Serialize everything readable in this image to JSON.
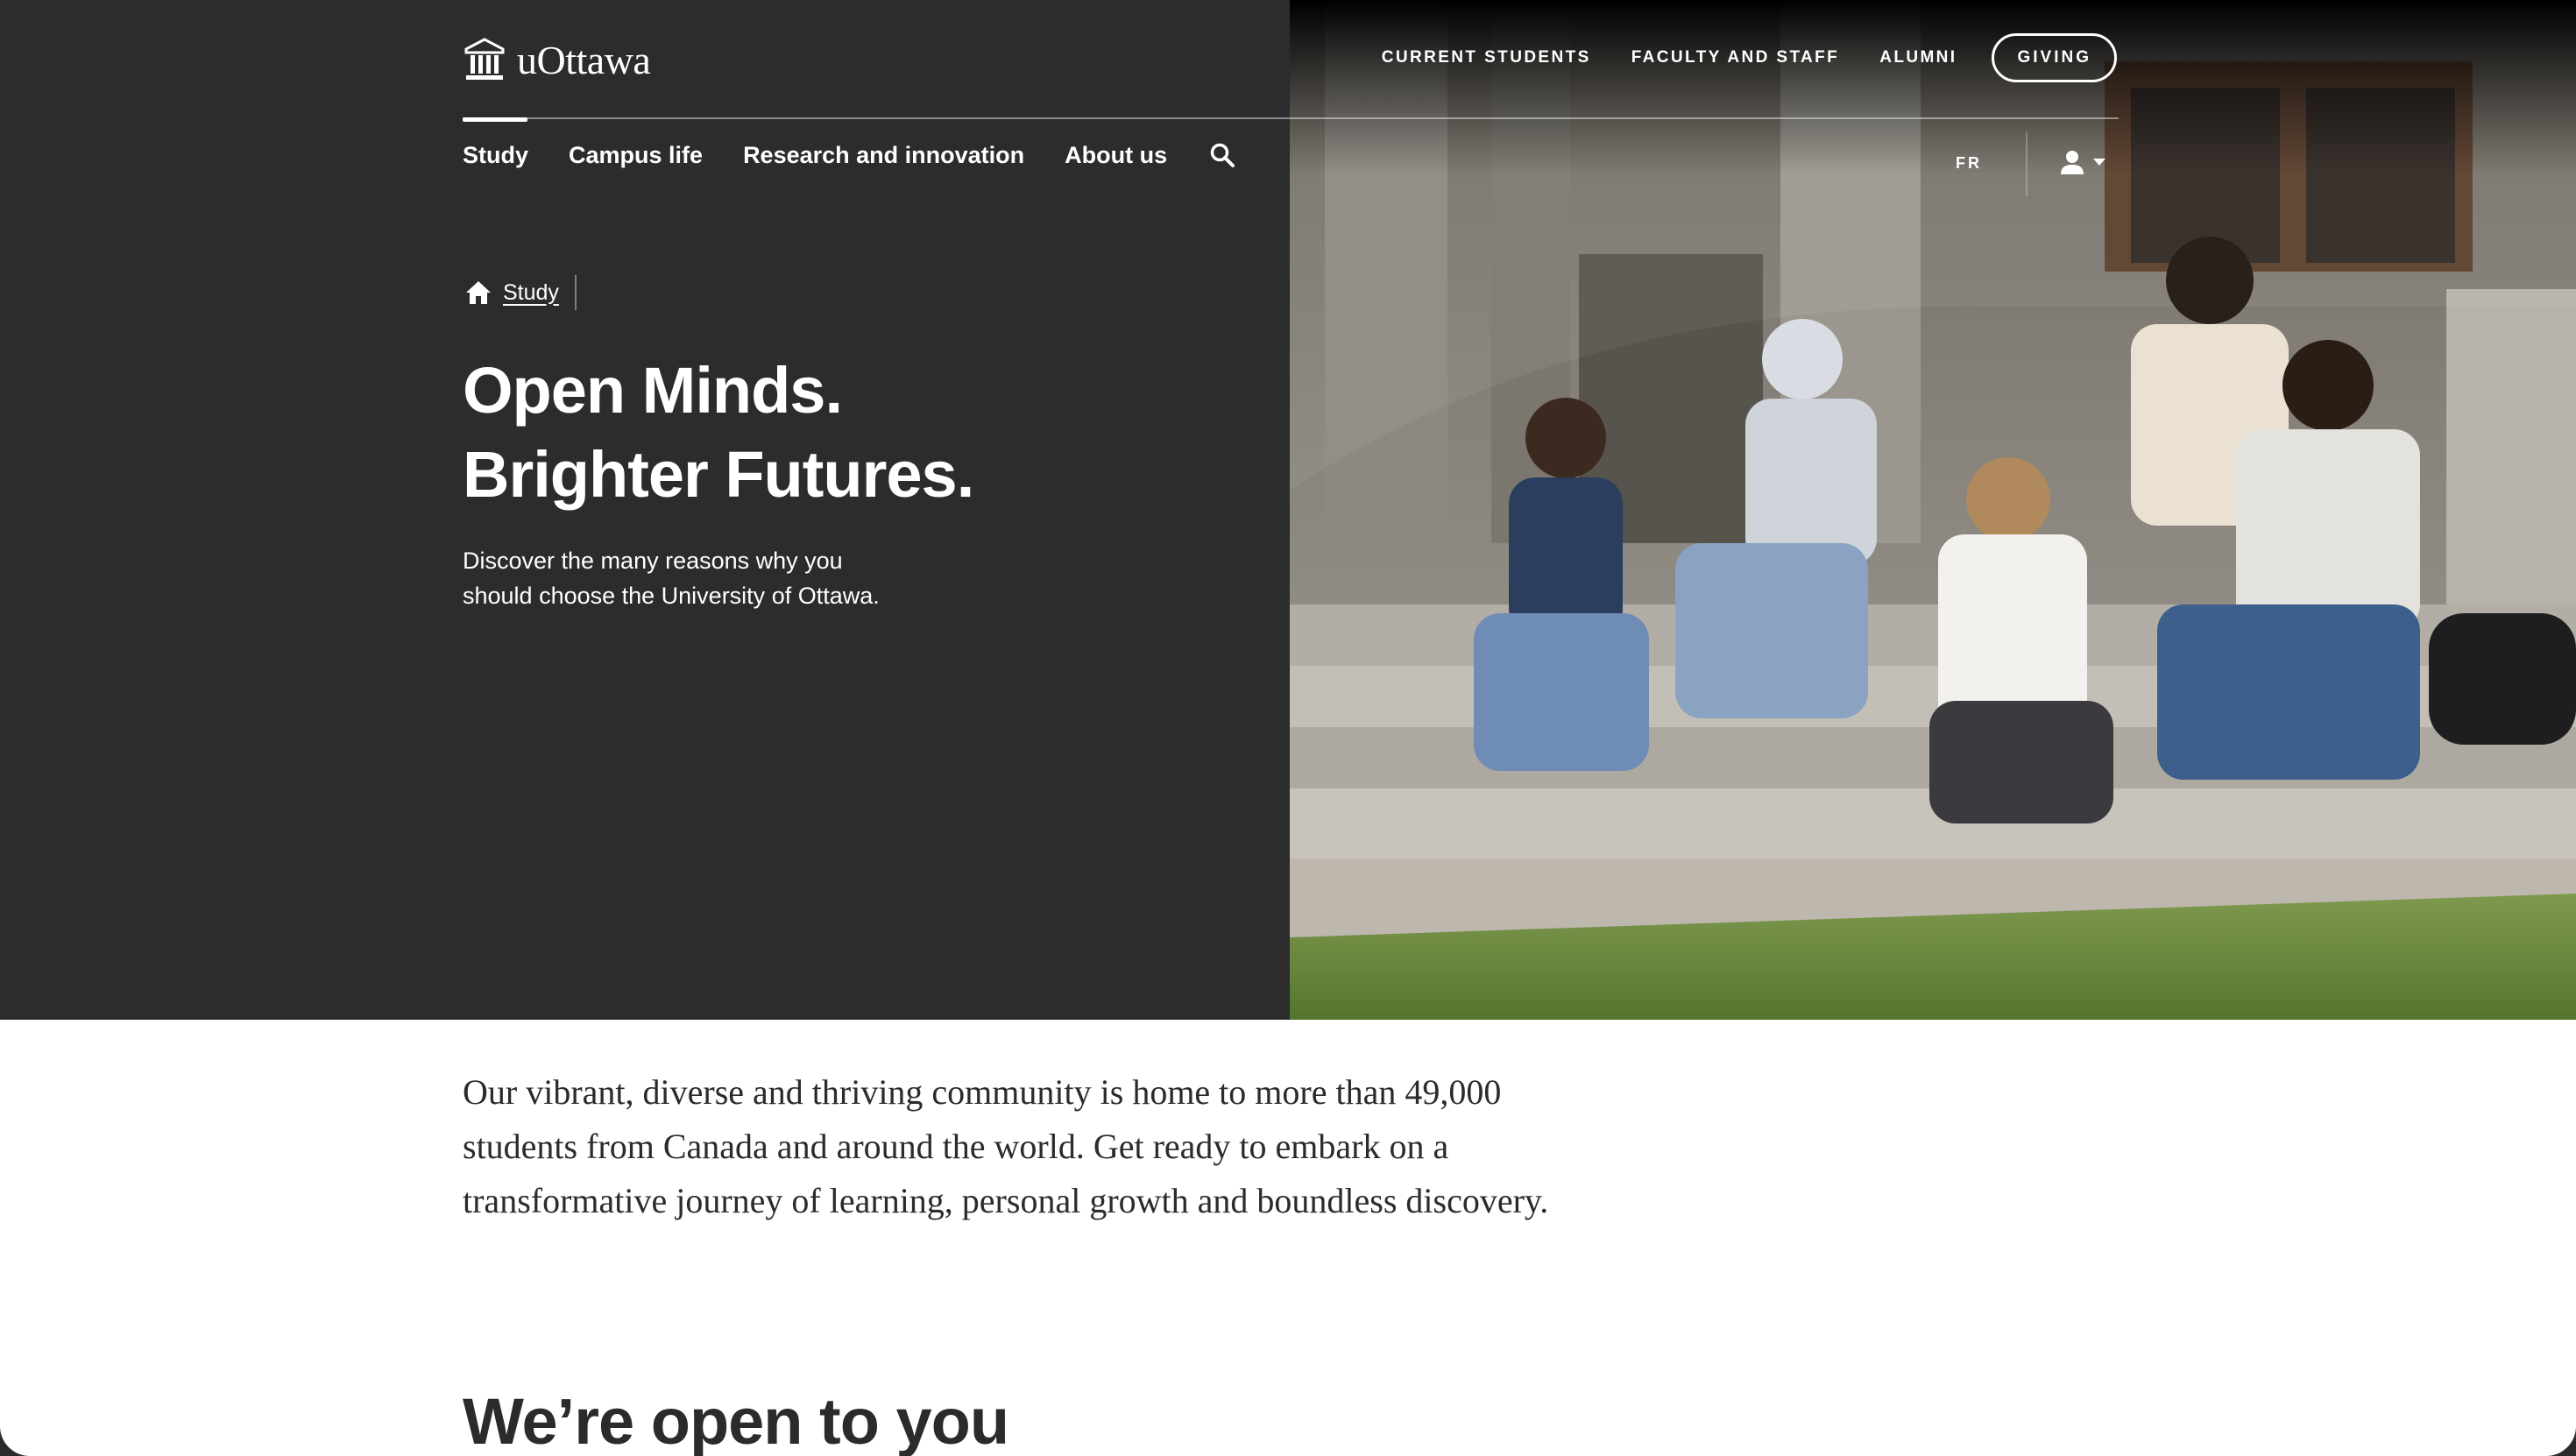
{
  "header": {
    "logo_text": "uOttawa",
    "utility_links": [
      "CURRENT STUDENTS",
      "FACULTY AND STAFF",
      "ALUMNI"
    ],
    "giving_label": "GIVING",
    "main_nav": [
      "Study",
      "Campus life",
      "Research and innovation",
      "About us"
    ],
    "active_nav": "Study",
    "language_toggle": "FR",
    "search_icon": "search-icon",
    "account_icon": "user-icon"
  },
  "breadcrumb": {
    "home_icon": "home-icon",
    "current": "Study"
  },
  "hero": {
    "title_line1": "Open Minds.",
    "title_line2": "Brighter Futures.",
    "subtitle_line1": "Discover the many reasons why you",
    "subtitle_line2": "should choose the University of Ottawa.",
    "image": "photo of five students sitting on stone steps outside a campus building"
  },
  "content": {
    "intro": "Our vibrant, diverse and thriving community is home to more than 49,000 students from Canada and around the world. Get ready to embark on a transformative journey of learning, personal growth and boundless discovery.",
    "section_heading": "We’re open to you"
  },
  "colors": {
    "hero_background": "#2c2c2c",
    "text_dark": "#2b2b2b",
    "text_light": "#ffffff"
  }
}
